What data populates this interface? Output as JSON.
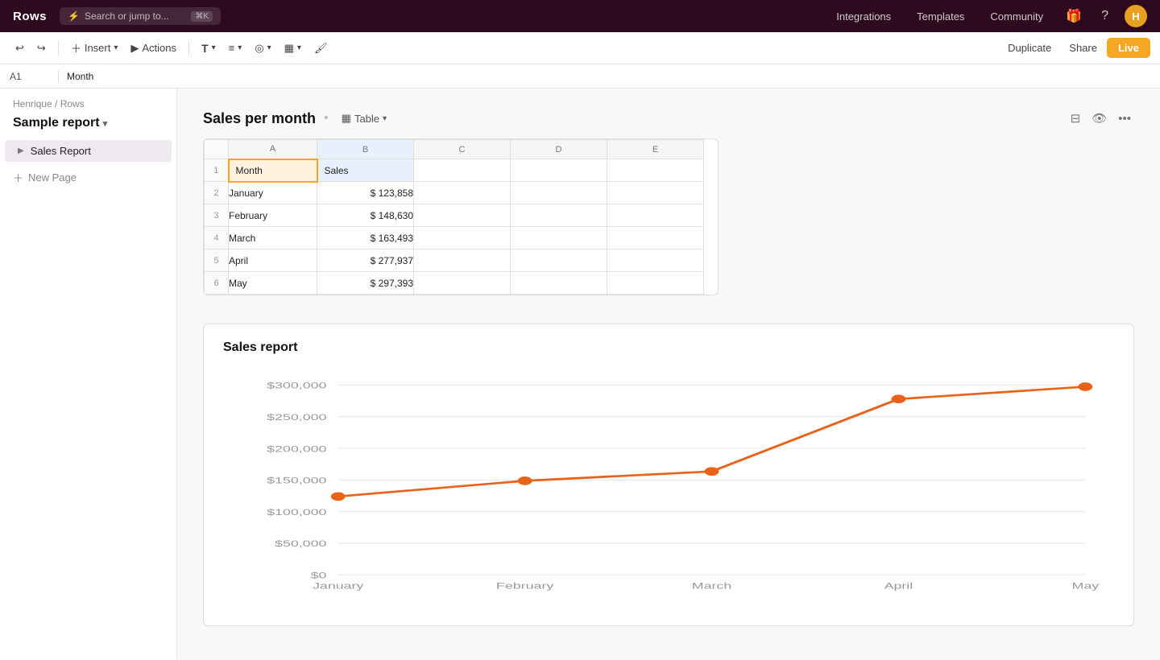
{
  "topnav": {
    "logo": "Rows",
    "search_placeholder": "Search or jump to...",
    "search_kbd": "⌘K",
    "links": [
      "Integrations",
      "Templates",
      "Community"
    ],
    "avatar_initial": "H"
  },
  "toolbar": {
    "undo_label": "↩",
    "redo_label": "↪",
    "insert_label": "Insert",
    "actions_label": "Actions",
    "text_style_label": "T",
    "align_label": "≡",
    "format_label": "◎",
    "table_layout_label": "▦",
    "paint_label": "🖌",
    "duplicate_label": "Duplicate",
    "share_label": "Share",
    "live_label": "Live"
  },
  "cell_ref": {
    "id": "A1",
    "value": "Month"
  },
  "sidebar": {
    "breadcrumb_user": "Henrique",
    "breadcrumb_sep": "/",
    "breadcrumb_workspace": "Rows",
    "report_title": "Sample report",
    "pages": [
      {
        "label": "Sales Report",
        "active": true
      }
    ],
    "new_page_label": "New Page"
  },
  "table_section": {
    "title": "Sales per month",
    "type_label": "Table",
    "col_headers": [
      "A",
      "B",
      "C",
      "D",
      "E"
    ],
    "row_headers": [
      1,
      2,
      3,
      4,
      5,
      6
    ],
    "header_row": [
      "Month",
      "Sales",
      "",
      "",
      ""
    ],
    "rows": [
      [
        "January",
        "$ 123,858",
        "",
        "",
        ""
      ],
      [
        "February",
        "$ 148,630",
        "",
        "",
        ""
      ],
      [
        "March",
        "$ 163,493",
        "",
        "",
        ""
      ],
      [
        "April",
        "$ 277,937",
        "",
        "",
        ""
      ],
      [
        "May",
        "$ 297,393",
        "",
        "",
        ""
      ]
    ]
  },
  "chart": {
    "title": "Sales report",
    "data": [
      {
        "month": "January",
        "value": 123858
      },
      {
        "month": "February",
        "value": 148630
      },
      {
        "month": "March",
        "value": 163493
      },
      {
        "month": "April",
        "value": 277937
      },
      {
        "month": "May",
        "value": 297393
      }
    ],
    "y_labels": [
      "$300,000",
      "$250,000",
      "$200,000",
      "$150,000",
      "$100,000",
      "$50,000",
      "$0"
    ],
    "x_labels": [
      "January",
      "February",
      "March",
      "April",
      "May"
    ],
    "max_value": 300000,
    "line_color": "#e8621a"
  }
}
